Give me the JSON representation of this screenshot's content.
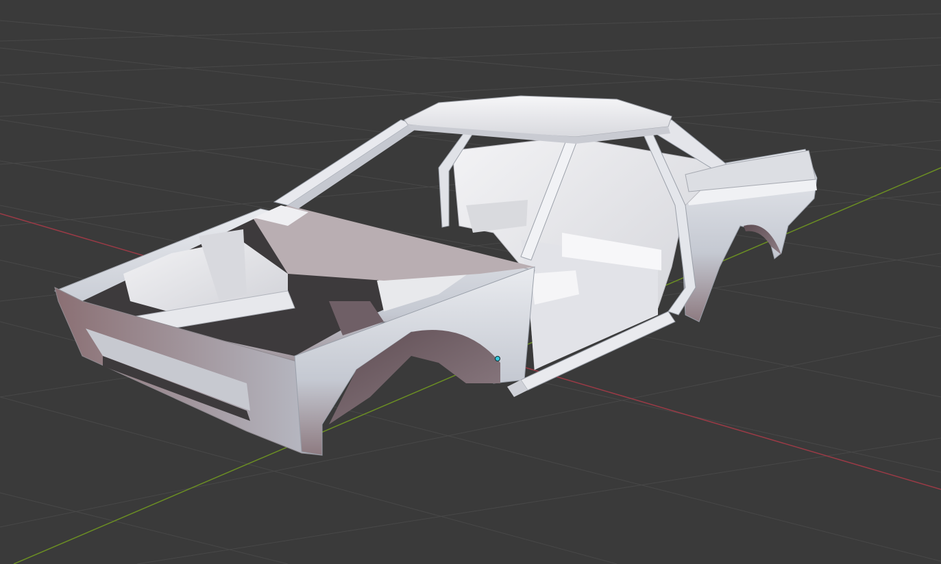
{
  "viewport": {
    "mode": "3d-viewport",
    "background_color": "#3a3a3a",
    "grid_color": "#4a4a4a",
    "x_axis_color": "#9b3a46",
    "y_axis_color": "#6b8e23",
    "origin_point_color": "#36c8dc"
  },
  "model": {
    "kind": "car-body-shell",
    "base_color": "#c9cdd6",
    "highlight_color": "#f4f4f6",
    "shadow_color": "#8e7f86",
    "interior_color": "#e6e6ea"
  }
}
